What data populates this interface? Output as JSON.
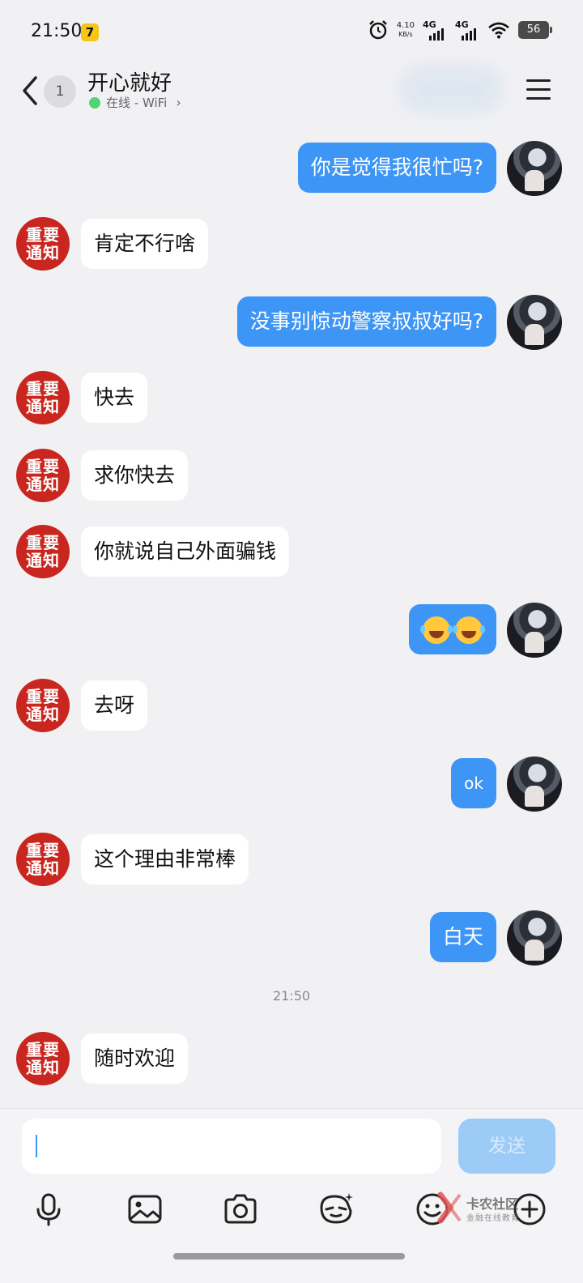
{
  "status_bar": {
    "time": "21:50",
    "app_badge": "7",
    "net_speed_value": "4.10",
    "net_speed_unit": "KB/s",
    "sim1": "4G",
    "sim2": "4G",
    "battery": "56"
  },
  "header": {
    "unread_count": "1",
    "contact_name": "开心就好",
    "online_status": "在线 - WiFi"
  },
  "messages": [
    {
      "side": "out",
      "text": "你是觉得我很忙吗?"
    },
    {
      "side": "in",
      "avatar_text": "重要通知",
      "text": "肯定不行啥"
    },
    {
      "side": "out",
      "text": "没事别惊动警察叔叔好吗?"
    },
    {
      "side": "in",
      "avatar_text": "重要通知",
      "text": "快去"
    },
    {
      "side": "in",
      "avatar_text": "重要通知",
      "text": "求你快去"
    },
    {
      "side": "in",
      "avatar_text": "重要通知",
      "text": "你就说自己外面骗钱"
    },
    {
      "side": "out",
      "emoji": "laugh-cry-emoji",
      "emoji_count": 2
    },
    {
      "side": "in",
      "avatar_text": "重要通知",
      "text": "去呀"
    },
    {
      "side": "out",
      "text": "ok"
    },
    {
      "side": "in",
      "avatar_text": "重要通知",
      "text": "这个理由非常棒"
    },
    {
      "side": "out",
      "text": "白天"
    },
    {
      "side": "in",
      "avatar_text": "重要通知",
      "text": "随时欢迎"
    }
  ],
  "timestamp": "21:50",
  "avatar_label_line1": "重要",
  "avatar_label_line2": "通知",
  "composer": {
    "input_value": "",
    "send_label": "发送"
  },
  "toolbar": [
    "mic-icon",
    "image-icon",
    "camera-icon",
    "sticker-icon",
    "emoji-icon",
    "plus-icon"
  ],
  "watermark": {
    "title": "卡农社区",
    "subtitle": "金融在线教育"
  },
  "colors": {
    "outgoing_bubble": "#3d95f5",
    "incoming_bubble": "#ffffff",
    "background": "#f1f1f4",
    "notice_avatar": "#c8261e",
    "online_dot": "#52d273"
  }
}
